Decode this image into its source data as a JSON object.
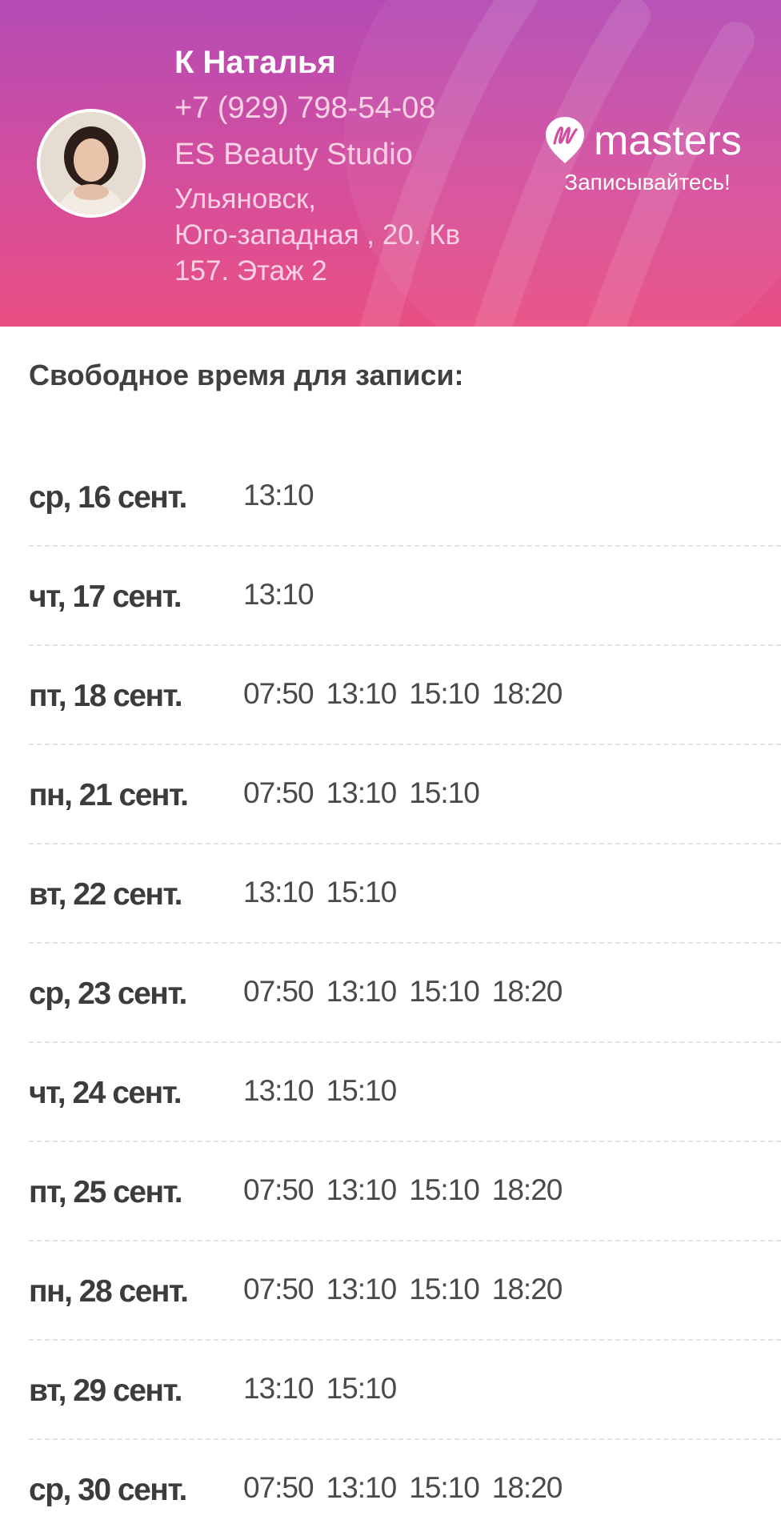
{
  "header": {
    "name": "К Наталья",
    "phone": "+7 (929) 798-54-08",
    "studio": "ES Beauty Studio",
    "address": "Ульяновск,\nЮго-западная , 20. Кв\n157. Этаж 2",
    "brand_name": "masters",
    "brand_tagline": "Записывайтесь!",
    "gradient_top": "#b44bb5",
    "gradient_bottom": "#e94f83"
  },
  "section_title": "Свободное время для записи:",
  "schedule": [
    {
      "date": "ср, 16 сент.",
      "times": [
        "13:10"
      ]
    },
    {
      "date": "чт, 17 сент.",
      "times": [
        "13:10"
      ]
    },
    {
      "date": "пт, 18 сент.",
      "times": [
        "07:50",
        "13:10",
        "15:10",
        "18:20"
      ]
    },
    {
      "date": "пн, 21 сент.",
      "times": [
        "07:50",
        "13:10",
        "15:10"
      ]
    },
    {
      "date": "вт, 22 сент.",
      "times": [
        "13:10",
        "15:10"
      ]
    },
    {
      "date": "ср, 23 сент.",
      "times": [
        "07:50",
        "13:10",
        "15:10",
        "18:20"
      ]
    },
    {
      "date": "чт, 24 сент.",
      "times": [
        "13:10",
        "15:10"
      ]
    },
    {
      "date": "пт, 25 сент.",
      "times": [
        "07:50",
        "13:10",
        "15:10",
        "18:20"
      ]
    },
    {
      "date": "пн, 28 сент.",
      "times": [
        "07:50",
        "13:10",
        "15:10",
        "18:20"
      ]
    },
    {
      "date": "вт, 29 сент.",
      "times": [
        "13:10",
        "15:10"
      ]
    },
    {
      "date": "ср, 30 сент.",
      "times": [
        "07:50",
        "13:10",
        "15:10",
        "18:20"
      ]
    }
  ]
}
